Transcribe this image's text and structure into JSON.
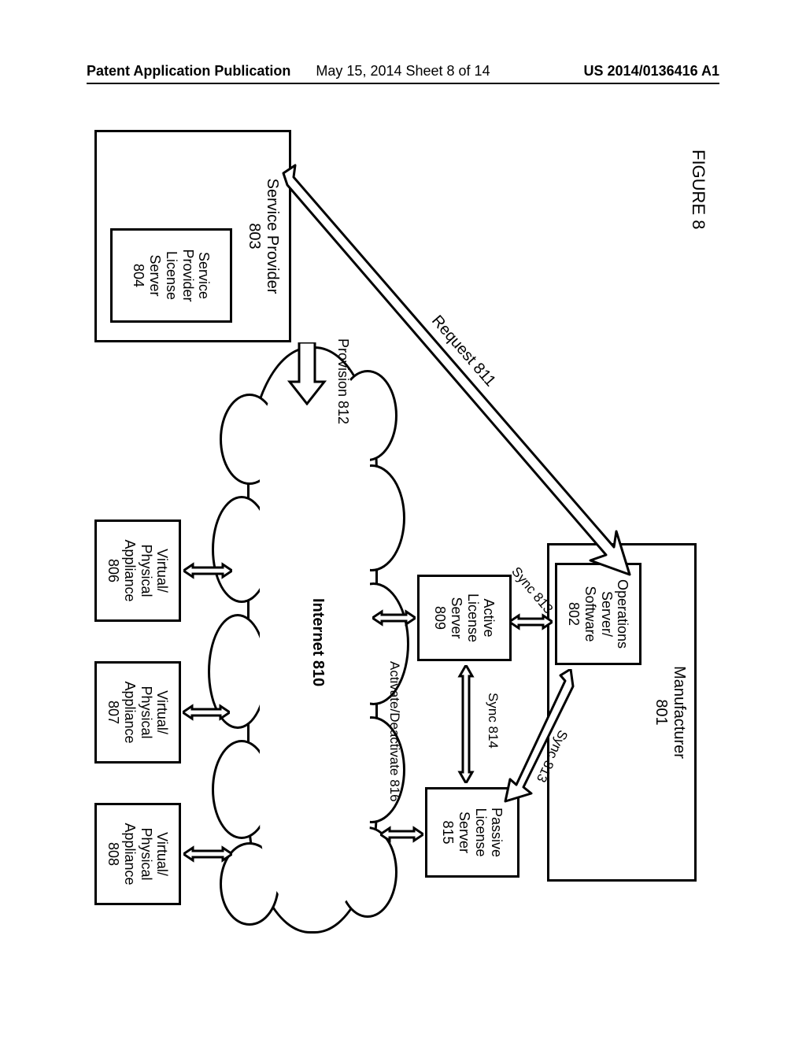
{
  "header": {
    "left": "Patent Application Publication",
    "center": "May 15, 2014  Sheet 8 of 14",
    "right": "US 2014/0136416 A1"
  },
  "figure": {
    "title": "FIGURE 8",
    "manufacturer": {
      "label": "Manufacturer\n801",
      "operations": "Operations\nServer/\nSoftware\n802"
    },
    "serviceProvider": {
      "label": "Service Provider\n803",
      "licenseServer": "Service\nProvider\nLicense\nServer\n804"
    },
    "activeLicense": "Active\nLicense\nServer\n809",
    "passiveLicense": "Passive\nLicense\nServer\n815",
    "internet": "Internet 810",
    "appliances": [
      "Virtual/\nPhysical\nAppliance\n806",
      "Virtual/\nPhysical\nAppliance\n807",
      "Virtual/\nPhysical\nAppliance\n808"
    ],
    "arrows": {
      "request": "Request 811",
      "provision": "Provision 812",
      "syncOpsActive": "Sync 813",
      "syncOpsPassive": "Sync 813",
      "syncBetween": "Sync 814",
      "activate": "Activate/Deactivate 816"
    }
  }
}
